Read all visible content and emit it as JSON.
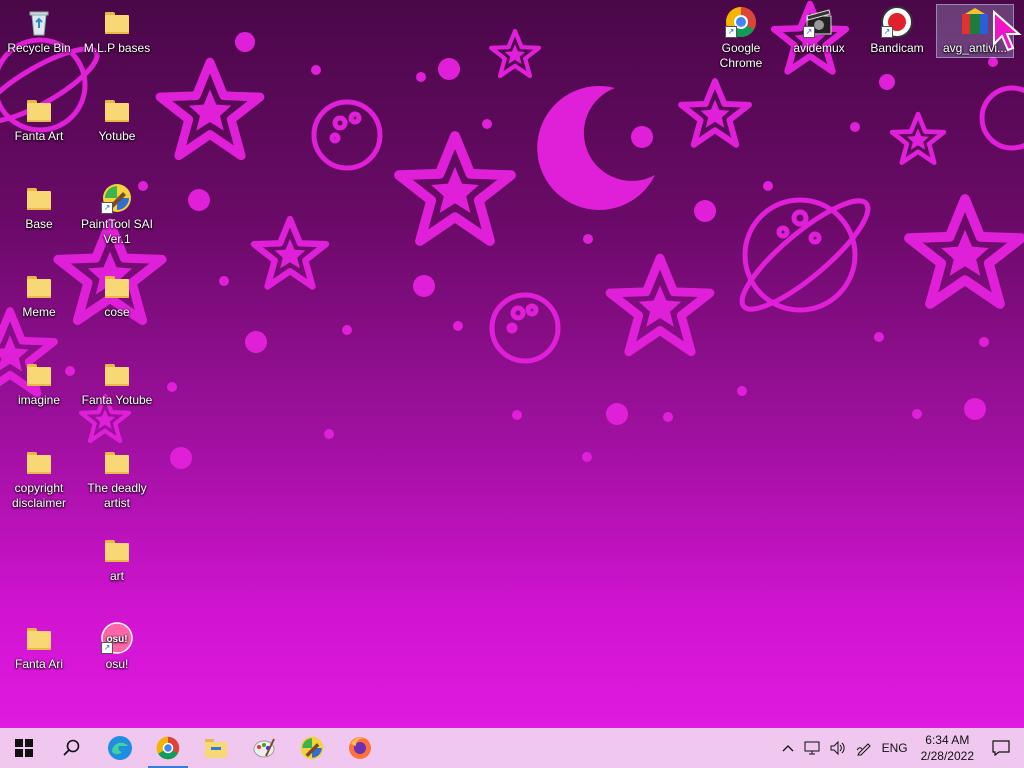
{
  "desktop": {
    "left_icons": [
      {
        "label": "Recycle Bin",
        "icon": "recycle-bin-icon"
      },
      {
        "label": "M.L.P bases",
        "icon": "folder-icon"
      },
      {
        "label": "Fanta Art",
        "icon": "folder-icon"
      },
      {
        "label": "Yotube",
        "icon": "folder-icon"
      },
      {
        "label": "Base",
        "icon": "folder-icon"
      },
      {
        "label": "PaintTool SAI Ver.1",
        "icon": "painttool-sai-icon"
      },
      {
        "label": "Meme",
        "icon": "folder-icon"
      },
      {
        "label": "cose",
        "icon": "folder-icon"
      },
      {
        "label": "imagine",
        "icon": "folder-icon"
      },
      {
        "label": "Fanta Yotube",
        "icon": "folder-icon"
      },
      {
        "label": "copyright disclaimer",
        "icon": "folder-icon"
      },
      {
        "label": "The deadly artist",
        "icon": "folder-icon"
      },
      {
        "label": "art",
        "icon": "folder-icon"
      },
      {
        "label": "Fanta Ari",
        "icon": "folder-icon"
      },
      {
        "label": "osu!",
        "icon": "osu-icon"
      }
    ],
    "right_icons": [
      {
        "label": "Google Chrome",
        "icon": "chrome-icon"
      },
      {
        "label": "avidemux",
        "icon": "avidemux-icon"
      },
      {
        "label": "Bandicam",
        "icon": "bandicam-icon"
      },
      {
        "label": "avg_antivi...",
        "icon": "avg-antivirus-icon"
      }
    ],
    "osu_badge": "osu!"
  },
  "taskbar": {
    "language": "ENG",
    "time": "6:34 AM",
    "date": "2/28/2022",
    "accent": "#3a7bd5",
    "background": "#f0c8ef"
  }
}
